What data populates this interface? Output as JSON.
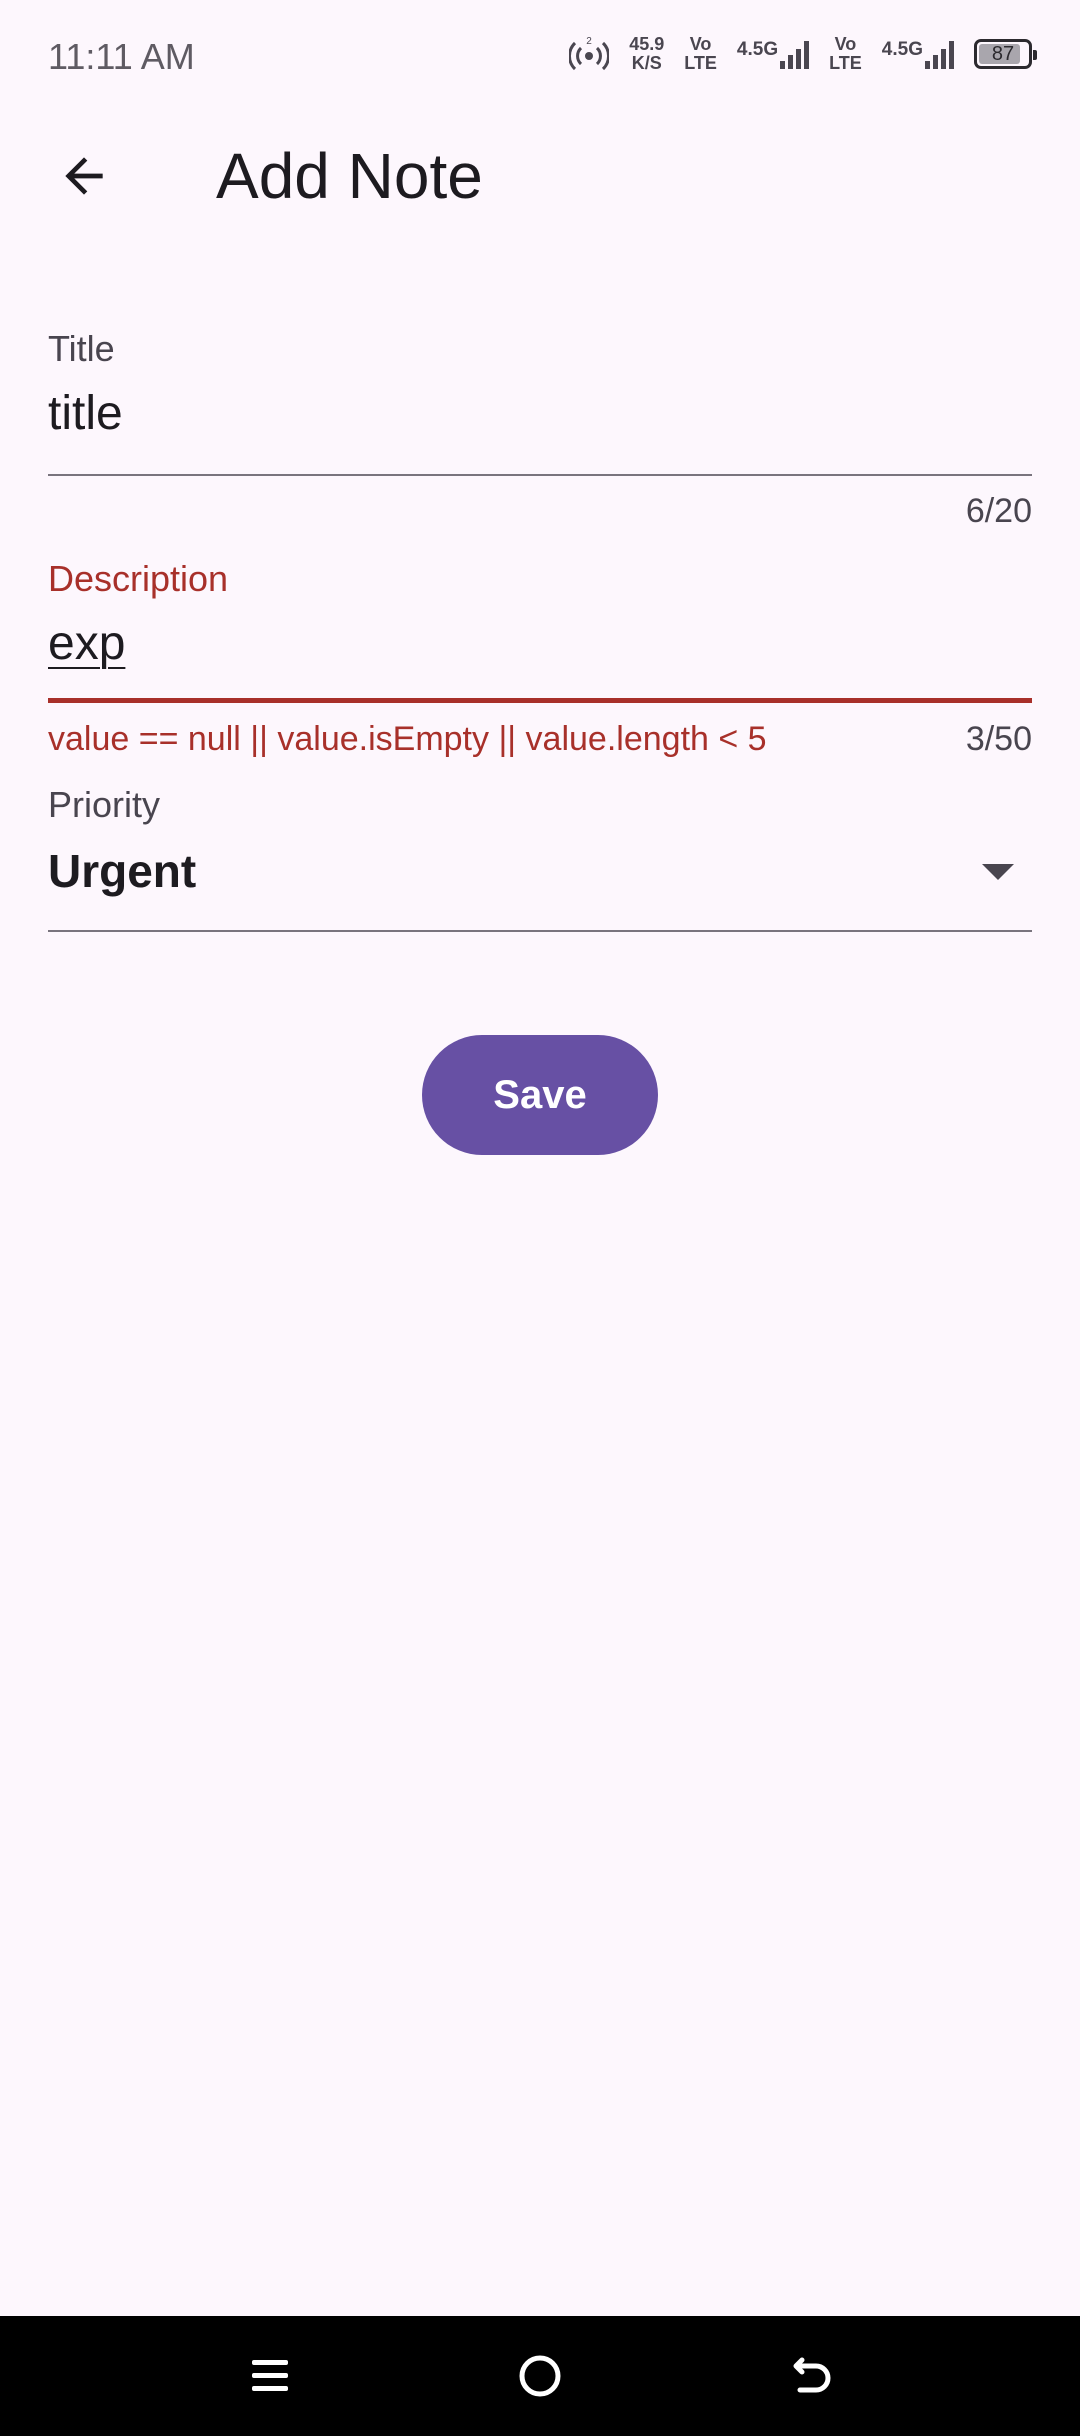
{
  "status_bar": {
    "time": "11:11 AM",
    "net_speed_value": "45.9",
    "net_speed_unit": "K/S",
    "hotspot_count": "2",
    "sim1": {
      "volte_top": "Vo",
      "volte_bottom": "LTE",
      "network": "4.5G"
    },
    "sim2": {
      "volte_top": "Vo",
      "volte_bottom": "LTE",
      "network": "4.5G"
    },
    "battery_level": "87"
  },
  "app_bar": {
    "title": "Add Note",
    "back_icon": "arrow-back-icon"
  },
  "form": {
    "title_field": {
      "label": "Title",
      "value": "title",
      "counter": "6/20"
    },
    "description_field": {
      "label": "Description",
      "value": "exp",
      "error": "value == null || value.isEmpty || value.length < 5",
      "counter": "3/50",
      "error_color": "#a8302a"
    },
    "priority_field": {
      "label": "Priority",
      "selected": "Urgent",
      "icon": "dropdown-arrow-icon"
    },
    "save_label": "Save",
    "accent_color": "#6750a4"
  },
  "nav_bar": {
    "menu_icon": "menu-icon",
    "home_icon": "home-icon",
    "back_icon": "back-icon"
  }
}
